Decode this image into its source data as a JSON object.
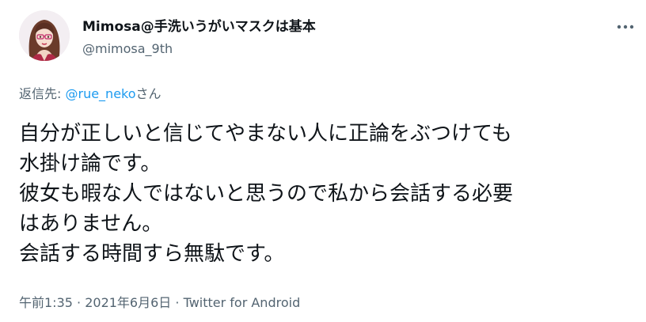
{
  "author": {
    "display_name": "Mimosa@手洗いうがいマスクは基本",
    "handle": "@mimosa_9th",
    "avatar_icon": "avatar-woman-glasses-icon"
  },
  "menu": {
    "more_icon": "more-horizontal-icon"
  },
  "reply": {
    "prefix": "返信先: ",
    "mention": "@rue_neko",
    "suffix": "さん"
  },
  "body": {
    "lines": [
      "自分が正しいと信じてやまない人に正論をぶつけても",
      "水掛け論です。",
      "彼女も暇な人ではないと思うので私から会話する必要",
      "はありません。",
      "会話する時間すら無駄です。"
    ]
  },
  "meta": {
    "time": "午前1:35",
    "separator": " · ",
    "date": "2021年6月6日",
    "source": "Twitter for Android"
  },
  "colors": {
    "text": "#0f1419",
    "secondary": "#536471",
    "link": "#1d9bf0"
  }
}
